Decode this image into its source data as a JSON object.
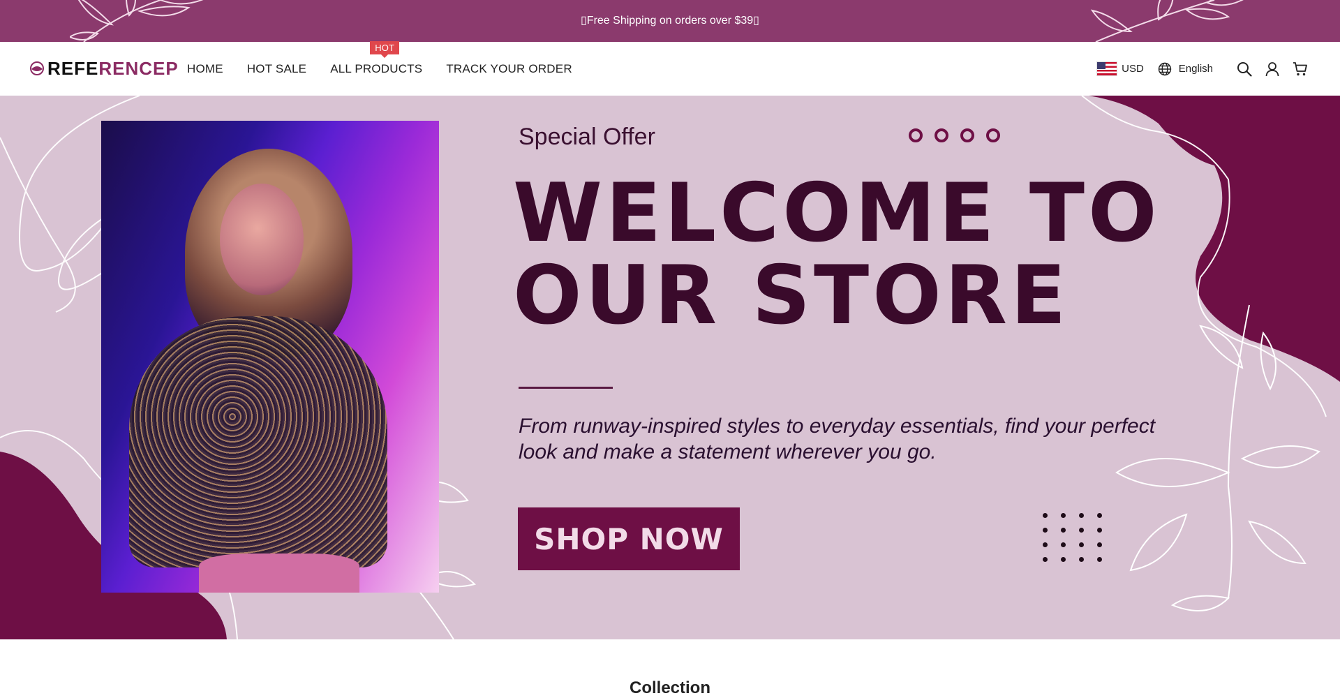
{
  "announcement": {
    "text": "🇫ree Shipping on orders over $39",
    "display": "▯Free Shipping on orders over $39▯"
  },
  "header": {
    "logo": {
      "part1": "REFE",
      "part2": "RENCEP"
    },
    "nav": [
      {
        "label": "HOME"
      },
      {
        "label": "HOT SALE"
      },
      {
        "label": "ALL PRODUCTS",
        "badge": "HOT"
      },
      {
        "label": "TRACK YOUR ORDER"
      }
    ],
    "currency": "USD",
    "language": "English",
    "icons": [
      "globe-icon",
      "search-icon",
      "account-icon",
      "cart-icon"
    ]
  },
  "hero": {
    "eyebrow": "Special Offer",
    "headline_line1": "WELCOME TO",
    "headline_line2": "OUR STORE",
    "subtext": "From runway-inspired styles to everyday essentials, find your perfect look and make a statement wherever you go.",
    "cta": "SHOP NOW",
    "slides": 4
  },
  "collection": {
    "title": "Collection"
  },
  "colors": {
    "brand": "#8b3a6d",
    "accent": "#6e0f45",
    "hero_bg": "#d9c3d3",
    "hot_badge": "#e0474c"
  }
}
